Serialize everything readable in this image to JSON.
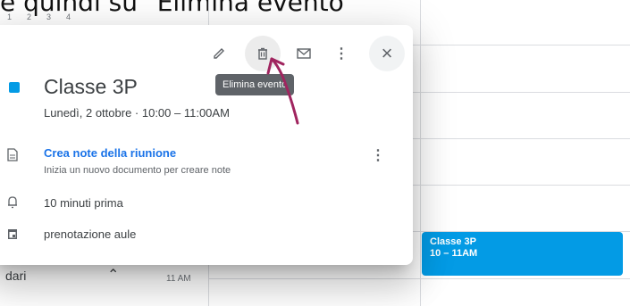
{
  "caption": "e quindi su \"Elimina evento\"",
  "mini_calendar": {
    "days": [
      "1",
      "2",
      "3",
      "4"
    ]
  },
  "bottom": {
    "calendars_label": "dari",
    "time_label": "11 AM",
    "cut_text": "..."
  },
  "event_chip": {
    "title": "Classe 3P",
    "time": "10 – 11AM",
    "color": "#039be5"
  },
  "popup": {
    "tooltip": "Elimina evento",
    "event_title": "Classe 3P",
    "event_when": "Lunedì, 2 ottobre  ·  10:00 – 11:00AM",
    "notes_link": "Crea note della riunione",
    "notes_hint": "Inizia un nuovo documento per creare note",
    "reminder": "10 minuti prima",
    "calendar_name": "prenotazione aule",
    "accent_color": "#039be5",
    "icons": {
      "edit": "pencil-icon",
      "delete": "trash-icon",
      "email": "mail-icon",
      "options": "more-vert-icon",
      "close": "close-icon"
    }
  },
  "annotation": {
    "color": "#a0255f",
    "shape": "arrow"
  }
}
